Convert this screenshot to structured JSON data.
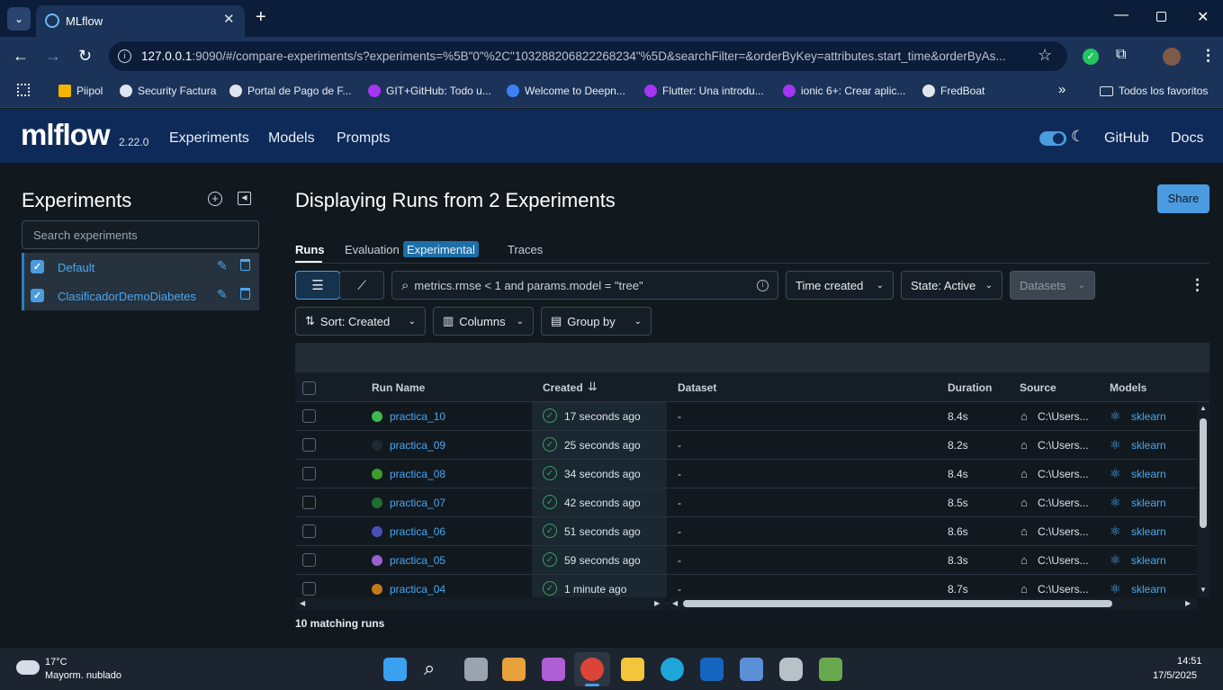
{
  "browser": {
    "tab_title": "MLflow",
    "url_host": "127.0.0.1",
    "url_rest": ":9090/#/compare-experiments/s?experiments=%5B\"0\"%2C\"103288206822268234\"%5D&searchFilter=&orderByKey=attributes.start_time&orderByAs...",
    "bookmarks": [
      "Piipol",
      "Security Factura",
      "Portal de Pago de F...",
      "GIT+GitHub: Todo u...",
      "Welcome to Deepn...",
      "Flutter: Una introdu...",
      "ionic 6+: Crear aplic...",
      "FredBoat"
    ],
    "all_bookmarks": "Todos los favoritos"
  },
  "header": {
    "logo": "mlflow",
    "version": "2.22.0",
    "nav": [
      "Experiments",
      "Models",
      "Prompts"
    ],
    "right_links": [
      "GitHub",
      "Docs"
    ]
  },
  "sidebar": {
    "title": "Experiments",
    "search_placeholder": "Search experiments",
    "experiments": [
      {
        "name": "Default",
        "checked": true
      },
      {
        "name": "ClasificadorDemoDiabetes",
        "checked": true
      }
    ]
  },
  "main": {
    "title": "Displaying Runs from 2 Experiments",
    "share_label": "Share",
    "tabs": {
      "runs": "Runs",
      "evaluation": "Evaluation",
      "experimental_badge": "Experimental",
      "traces": "Traces"
    },
    "filter_placeholder": "metrics.rmse < 1 and params.model = \"tree\"",
    "time_created": "Time created",
    "state": "State: Active",
    "datasets": "Datasets",
    "sort": "Sort: Created",
    "columns": "Columns",
    "group_by": "Group by",
    "columns_headers": [
      "Run Name",
      "Created",
      "Dataset",
      "Duration",
      "Source",
      "Models"
    ],
    "runs": [
      {
        "name": "practica_10",
        "created": "17 seconds ago",
        "dataset": "-",
        "duration": "8.4s",
        "source": "C:\\Users...",
        "model": "sklearn",
        "color": "#3fb950"
      },
      {
        "name": "practica_09",
        "created": "25 seconds ago",
        "dataset": "-",
        "duration": "8.2s",
        "source": "C:\\Users...",
        "model": "sklearn",
        "color": "#1d2933"
      },
      {
        "name": "practica_08",
        "created": "34 seconds ago",
        "dataset": "-",
        "duration": "8.4s",
        "source": "C:\\Users...",
        "model": "sklearn",
        "color": "#3d9a2f"
      },
      {
        "name": "practica_07",
        "created": "42 seconds ago",
        "dataset": "-",
        "duration": "8.5s",
        "source": "C:\\Users...",
        "model": "sklearn",
        "color": "#1f6d2f"
      },
      {
        "name": "practica_06",
        "created": "51 seconds ago",
        "dataset": "-",
        "duration": "8.6s",
        "source": "C:\\Users...",
        "model": "sklearn",
        "color": "#4b4fb8"
      },
      {
        "name": "practica_05",
        "created": "59 seconds ago",
        "dataset": "-",
        "duration": "8.3s",
        "source": "C:\\Users...",
        "model": "sklearn",
        "color": "#9a5fd0"
      },
      {
        "name": "practica_04",
        "created": "1 minute ago",
        "dataset": "-",
        "duration": "8.7s",
        "source": "C:\\Users...",
        "model": "sklearn",
        "color": "#c27a17"
      }
    ],
    "matching": "10 matching runs"
  },
  "taskbar": {
    "temp": "17°C",
    "weather": "Mayorm. nublado",
    "time": "14:51",
    "date": "17/5/2025"
  }
}
